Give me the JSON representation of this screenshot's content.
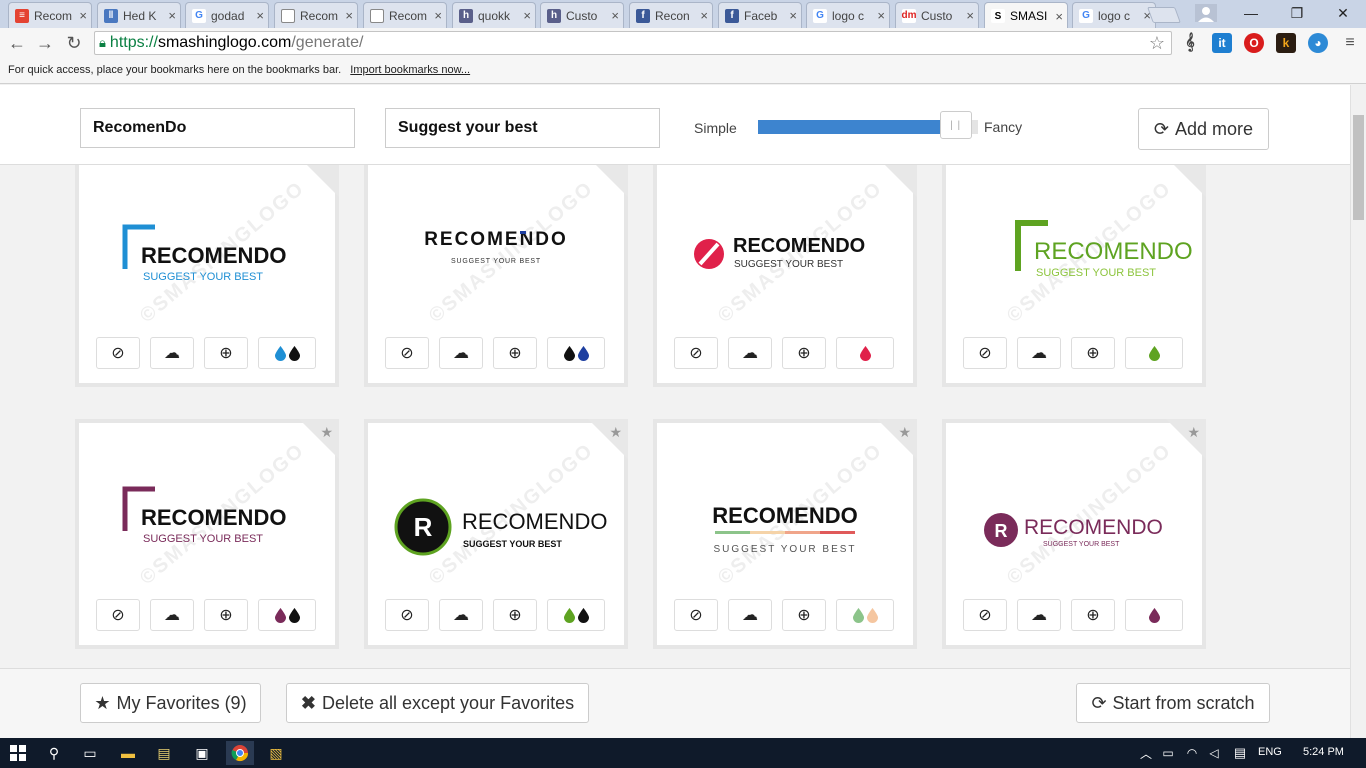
{
  "browser": {
    "tabs": [
      {
        "title": "Recom",
        "favicon": "todoist",
        "color": "#e44332",
        "glyph": "≡"
      },
      {
        "title": "Hed K",
        "favicon": "trello",
        "color": "#4a78c0",
        "glyph": "‖"
      },
      {
        "title": "godad",
        "favicon": "google",
        "color": "#ffffff",
        "glyph": "G"
      },
      {
        "title": "Recom",
        "favicon": "document",
        "color": "#ffffff",
        "glyph": ""
      },
      {
        "title": "Recom",
        "favicon": "document",
        "color": "#ffffff",
        "glyph": ""
      },
      {
        "title": "quokk",
        "favicon": "hackpad",
        "color": "#5a5f8a",
        "glyph": "h"
      },
      {
        "title": "Custo",
        "favicon": "hackpad",
        "color": "#5a5f8a",
        "glyph": "h"
      },
      {
        "title": "Recon",
        "favicon": "facebook",
        "color": "#3b5998",
        "glyph": "f"
      },
      {
        "title": "Faceb",
        "favicon": "facebook",
        "color": "#3b5998",
        "glyph": "f"
      },
      {
        "title": "logo c",
        "favicon": "google",
        "color": "#ffffff",
        "glyph": "G"
      },
      {
        "title": "Custo",
        "favicon": "designmantic",
        "color": "#ffffff",
        "glyph": "dm"
      },
      {
        "title": "SMASI",
        "favicon": "smashinglogo",
        "color": "#ffffff",
        "glyph": "S",
        "active": true
      },
      {
        "title": "logo c",
        "favicon": "google",
        "color": "#ffffff",
        "glyph": "G"
      }
    ],
    "url": {
      "protocol": "https://",
      "host": "smashinglogo.com",
      "path": "/generate/"
    },
    "bookmarks_hint": "For quick access, place your bookmarks here on the bookmarks bar.",
    "bookmarks_import": "Import bookmarks now..."
  },
  "header": {
    "company_name": "RecomenDo",
    "tagline": "Suggest your best",
    "slider": {
      "left_label": "Simple",
      "right_label": "Fancy",
      "value_percent": 88,
      "accent": "#3d84cf"
    },
    "add_more_label": "Add more"
  },
  "logos": [
    {
      "name": "RECOMENDO",
      "tagline": "SUGGEST YOUR BEST",
      "style": "bracket",
      "name_color": "#111111",
      "tag_color": "#1f8fd4",
      "mark_color": "#1f8fd4",
      "favorited": false,
      "drops": [
        "#1f8fd4",
        "#111111"
      ]
    },
    {
      "name": "RECOMENDO",
      "tagline": "SUGGEST YOUR BEST",
      "style": "spaced",
      "name_color": "#111111",
      "tag_color": "#333333",
      "mark_color": "#1e3fa0",
      "favorited": false,
      "drops": [
        "#111111",
        "#1e3fa0"
      ]
    },
    {
      "name": "RECOMENDO",
      "tagline": "SUGGEST YOUR BEST",
      "style": "circle-slash",
      "name_color": "#111111",
      "tag_color": "#333333",
      "mark_color": "#e0214a",
      "favorited": false,
      "drops": [
        "#e0214a"
      ]
    },
    {
      "name": "RECOMENDO",
      "tagline": "SUGGEST YOUR BEST",
      "style": "bracket-big",
      "name_color": "#5ea321",
      "tag_color": "#8cc43c",
      "mark_color": "#5ea321",
      "favorited": false,
      "drops": [
        "#5ea321"
      ]
    },
    {
      "name": "RECOMENDO",
      "tagline": "SUGGEST YOUR BEST",
      "style": "bracket",
      "name_color": "#111111",
      "tag_color": "#7a2b5a",
      "mark_color": "#7a2b5a",
      "favorited": true,
      "drops": [
        "#7a2b5a",
        "#111111"
      ]
    },
    {
      "name": "RECOMENDO",
      "tagline": "SUGGEST YOUR BEST",
      "style": "circle-letter",
      "name_color": "#111111",
      "tag_color": "#111111",
      "mark_color": "#111111",
      "ring_color": "#5ea321",
      "letter": "R",
      "favorited": true,
      "drops": [
        "#5ea321",
        "#111111"
      ]
    },
    {
      "name": "RECOMENDO",
      "tagline": "SUGGEST YOUR BEST",
      "style": "underline-gradient",
      "name_color": "#111111",
      "tag_color": "#555555",
      "mark_color": "#8cc48a",
      "favorited": true,
      "drops": [
        "#8cc48a",
        "#f5c6a0"
      ]
    },
    {
      "name": "RECOMENDO",
      "tagline": "SUGGEST YOUR BEST",
      "style": "circle-letter-thin",
      "name_color": "#7a2b5a",
      "tag_color": "#7a2b5a",
      "mark_color": "#7a2b5a",
      "letter": "R",
      "favorited": true,
      "drops": [
        "#7a2b5a"
      ]
    }
  ],
  "watermark": "©SMASHINGLOGO",
  "footer": {
    "favorites_label": "My Favorites (9)",
    "delete_label": "Delete all except your Favorites",
    "restart_label": "Start from scratch"
  },
  "taskbar": {
    "language": "ENG",
    "time": "5:24 PM"
  }
}
